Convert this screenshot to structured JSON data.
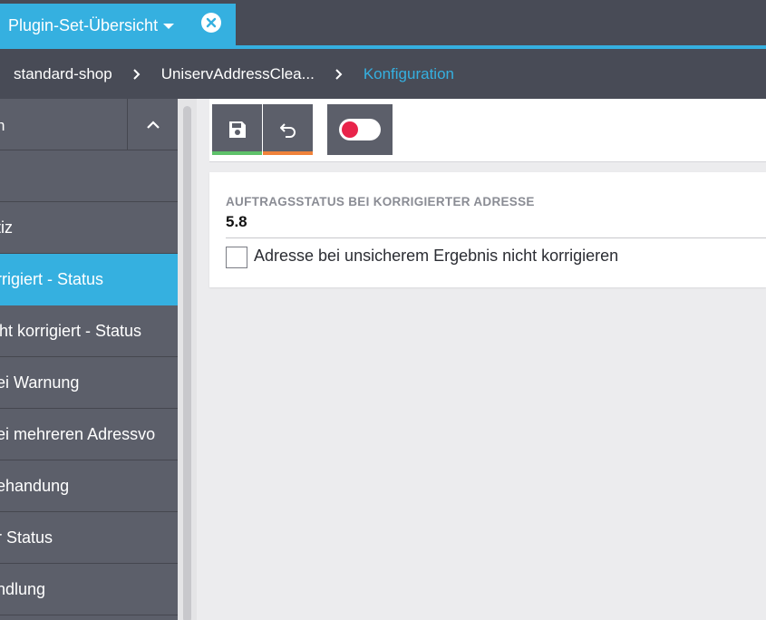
{
  "tab": {
    "label": "Plugin-Set-Übersicht"
  },
  "breadcrumb": {
    "items": [
      "standard-shop",
      "UniservAddressClea...",
      "Konfiguration"
    ]
  },
  "sidebar": {
    "header_label": "n",
    "items": [
      {
        "label": ""
      },
      {
        "label": "otiz"
      },
      {
        "label": "orrigiert - Status"
      },
      {
        "label": "icht korrigiert - Status"
      },
      {
        "label": "bei Warnung"
      },
      {
        "label": "bei mehreren Adressvo"
      },
      {
        "label": "behandung"
      },
      {
        "label": "er Status"
      },
      {
        "label": "andlung"
      }
    ]
  },
  "config": {
    "field_label": "AUFTRAGSSTATUS BEI KORRIGIERTER ADRESSE",
    "field_value": "5.8",
    "checkbox_label": "Adresse bei unsicherem Ergebnis nicht korrigieren"
  },
  "colors": {
    "accent": "#35b0e0",
    "dark_bar": "#484b56",
    "sidebar": "#5c5f6a",
    "save_indicator": "#5ec16a",
    "undo_indicator": "#f0823a",
    "toggle_off": "#e8244a"
  },
  "icons": {
    "tab_close": "close-circle-icon",
    "breadcrumb_separator": "chevron-right-icon",
    "sidebar_collapse": "chevron-up-icon",
    "save": "floppy-disk-icon",
    "undo": "undo-icon"
  }
}
